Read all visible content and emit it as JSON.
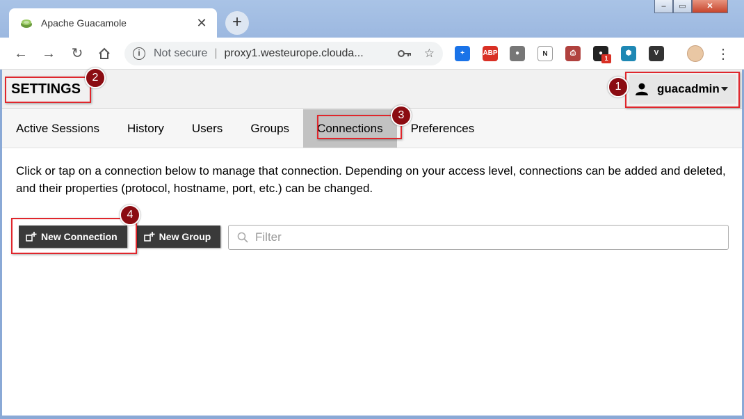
{
  "browser": {
    "tab_title": "Apache Guacamole",
    "tab_close": "✕",
    "new_tab": "+",
    "security_label": "Not secure",
    "url": "proxy1.westeurope.clouda...",
    "extension_badge": "1",
    "extensions": [
      {
        "name": "plus-extension",
        "color": "#1a73e8",
        "glyph": "+"
      },
      {
        "name": "adblock-plus",
        "color": "#d93025",
        "glyph": "ABP"
      },
      {
        "name": "orb-extension",
        "color": "#777777",
        "glyph": "●"
      },
      {
        "name": "n-extension",
        "color": "#ffffff",
        "glyph": "N"
      },
      {
        "name": "pdf-extension",
        "color": "#b0413e",
        "glyph": "⎙"
      },
      {
        "name": "chat-extension",
        "color": "#222222",
        "glyph": "●"
      },
      {
        "name": "hex-extension",
        "color": "#1e88b4",
        "glyph": "⬢"
      },
      {
        "name": "vc-extension",
        "color": "#333333",
        "glyph": "V"
      }
    ]
  },
  "header": {
    "title": "SETTINGS",
    "username": "guacadmin"
  },
  "tabs": [
    {
      "label": "Active Sessions",
      "active": false
    },
    {
      "label": "History",
      "active": false
    },
    {
      "label": "Users",
      "active": false
    },
    {
      "label": "Groups",
      "active": false
    },
    {
      "label": "Connections",
      "active": true
    },
    {
      "label": "Preferences",
      "active": false
    }
  ],
  "main": {
    "description": "Click or tap on a connection below to manage that connection. Depending on your access level, connections can be added and deleted, and their properties (protocol, hostname, port, etc.) can be changed.",
    "new_connection_label": "New Connection",
    "new_group_label": "New Group",
    "filter_placeholder": "Filter"
  },
  "annotations": {
    "marker_1": "1",
    "marker_2": "2",
    "marker_3": "3",
    "marker_4": "4",
    "color": "#e0262c",
    "marker_color": "#8b0c12"
  }
}
